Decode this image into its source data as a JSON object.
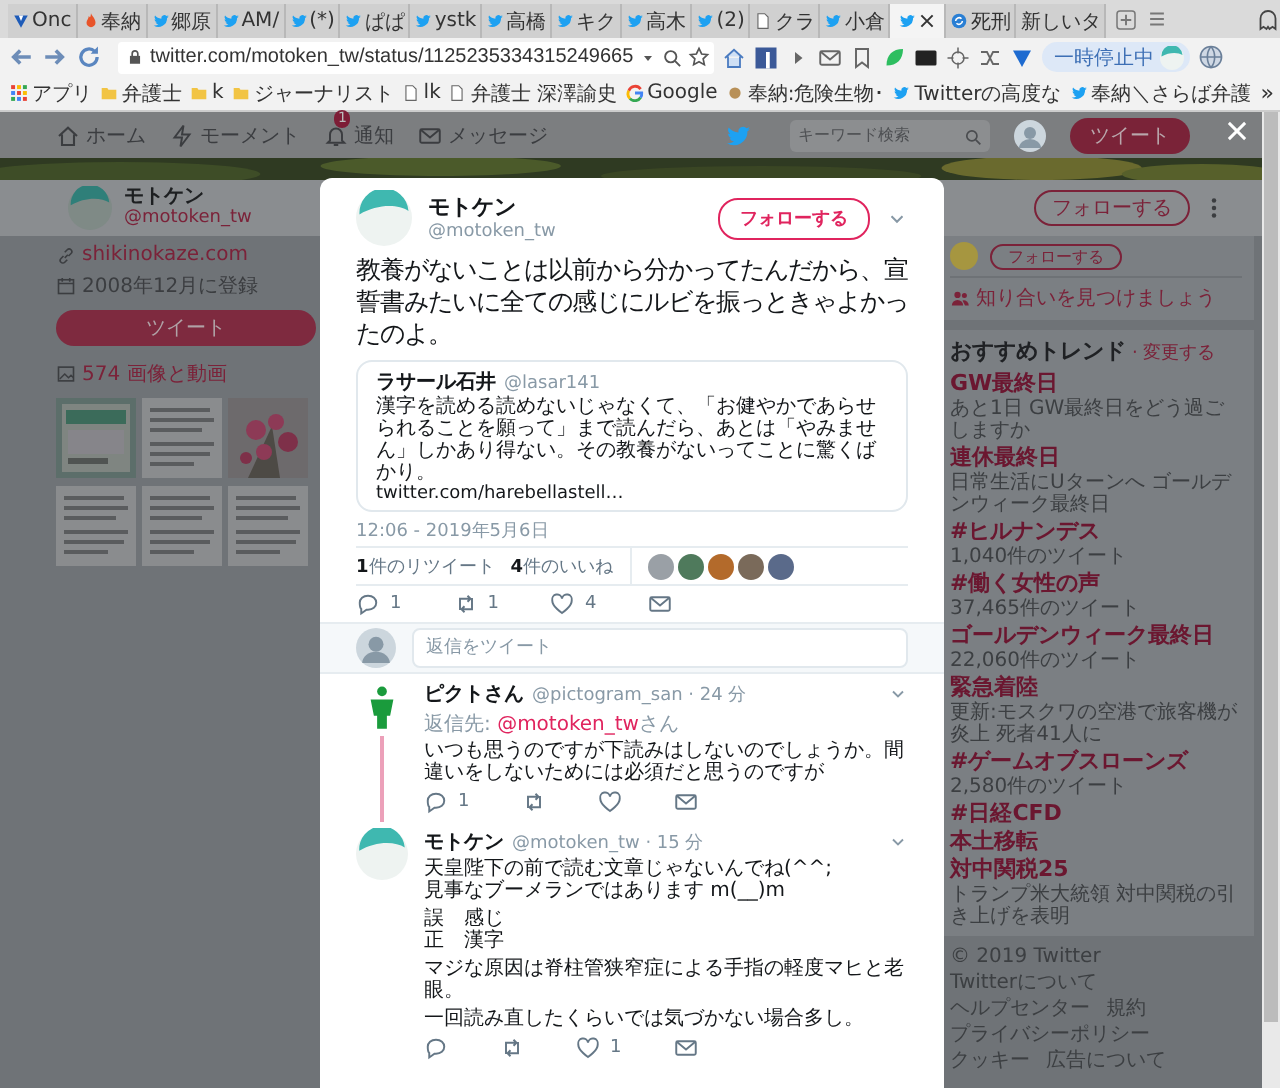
{
  "browser": {
    "tabs": [
      {
        "label": "Onc",
        "kind": "triangle",
        "selected": false
      },
      {
        "label": "奉納",
        "kind": "flame",
        "selected": false
      },
      {
        "label": "郷原",
        "kind": "bird",
        "selected": false
      },
      {
        "label": "AM/",
        "kind": "bird",
        "selected": false
      },
      {
        "label": "(*)",
        "kind": "bird",
        "selected": false
      },
      {
        "label": "ぱぱ",
        "kind": "bird",
        "selected": false
      },
      {
        "label": "ystk",
        "kind": "bird",
        "selected": false
      },
      {
        "label": "高橋",
        "kind": "bird",
        "selected": false
      },
      {
        "label": "キク",
        "kind": "bird",
        "selected": false
      },
      {
        "label": "高木",
        "kind": "bird",
        "selected": false
      },
      {
        "label": "(2)",
        "kind": "bird",
        "selected": false
      },
      {
        "label": "クラ",
        "kind": "page",
        "selected": false
      },
      {
        "label": "小倉",
        "kind": "bird",
        "selected": false
      },
      {
        "kind": "bird",
        "selected": true
      },
      {
        "label": "死刑",
        "kind": "sync",
        "selected": false
      },
      {
        "label": "新しいタ",
        "kind": "plain",
        "selected": false
      }
    ],
    "address": "twitter.com/motoken_tw/status/1125235334315249665",
    "pause_button": "一時停止中",
    "bookmarks": [
      {
        "label": "アプリ",
        "kind": "apps"
      },
      {
        "label": "弁護士",
        "kind": "folder"
      },
      {
        "label": "k",
        "kind": "folder"
      },
      {
        "label": "ジャーナリスト",
        "kind": "folder"
      },
      {
        "label": "lk",
        "kind": "page"
      },
      {
        "label": "弁護士 深澤諭史",
        "kind": "page"
      },
      {
        "label": "Google",
        "kind": "ring"
      },
      {
        "label": "奉納:危険生物･",
        "kind": "dot"
      },
      {
        "label": "Twitterの高度な",
        "kind": "bird"
      },
      {
        "label": "奉納＼さらば弁護",
        "kind": "bird"
      }
    ],
    "more_bookmarks": "»"
  },
  "twitter_nav": {
    "items": [
      {
        "label": "ホーム",
        "kind": "home"
      },
      {
        "label": "モーメント",
        "kind": "bolt"
      },
      {
        "label": "通知",
        "kind": "bell",
        "badge": "1"
      },
      {
        "label": "メッセージ",
        "kind": "mail"
      }
    ],
    "search": {
      "placeholder": "キーワード検索"
    },
    "tweet_button": "ツイート"
  },
  "profile": {
    "name": "モトケン",
    "handle": "@motoken_tw",
    "follow_button": "フォローする",
    "url": "shikinokaze.com",
    "joined": "2008年12月に登録",
    "tweet_button": "ツイート",
    "media_link": "574 画像と動画"
  },
  "who_to_follow": {
    "follow_button": "フォローする",
    "find_friends": "知り合いを見つけましょう"
  },
  "trends": {
    "title": "おすすめトレンド",
    "change": "· 変更する",
    "items": [
      {
        "name": "GW最終日",
        "desc": "あと1日 GW最終日をどう過ごしますか"
      },
      {
        "name": "連休最終日",
        "desc": "日常生活にUターンへ ゴールデンウィーク最終日"
      },
      {
        "name": "#ヒルナンデス",
        "desc": "1,040件のツイート"
      },
      {
        "name": "#働く女性の声",
        "desc": "37,465件のツイート"
      },
      {
        "name": "ゴールデンウィーク最終日",
        "desc": "22,060件のツイート"
      },
      {
        "name": "緊急着陸",
        "desc": "更新:モスクワの空港で旅客機が炎上 死者41人に"
      },
      {
        "name": "#ゲームオブスローンズ",
        "desc": "2,580件のツイート"
      },
      {
        "name": "#日経CFD"
      },
      {
        "name": "本土移転"
      },
      {
        "name": "対中関税25",
        "desc": "トランプ米大統領 対中関税の引き上げを表明"
      }
    ]
  },
  "footer": [
    "© 2019 Twitter",
    "Twitterについて",
    "ヘルプセンター",
    "規約",
    "プライバシーポリシー",
    "クッキー",
    "広告について"
  ],
  "tweet": {
    "name": "モトケン",
    "handle": "@motoken_tw",
    "follow_button": "フォローする",
    "text": "教養がないことは以前から分かってたんだから、宣誓書みたいに全ての感じにルビを振っときゃよかったのよ。",
    "quote": {
      "name": "ラサール石井",
      "handle": "@lasar141",
      "text": "漢字を読める読めないじゃなくて、「お健やかであらせられることを願って」まで読んだら、あとは「やみません」しかあり得ない。その教養がないってことに驚くばかり。",
      "link": "twitter.com/harebellastell…"
    },
    "time": "12:06 - 2019年5月6日",
    "retweets": "**1**件のリツイート",
    "likes": "**4**件のいいね",
    "likers": [
      {
        "kind": "avatar"
      },
      {
        "kind": "avatar"
      },
      {
        "kind": "avatar"
      },
      {
        "kind": "avatar"
      },
      {
        "kind": "avatar"
      }
    ],
    "actions": [
      {
        "kind": "reply",
        "count": "1"
      },
      {
        "kind": "retweet",
        "count": "1"
      },
      {
        "kind": "like",
        "count": "4"
      },
      {
        "kind": "message"
      }
    ],
    "reply_field": {
      "placeholder": "返信をツイート"
    }
  },
  "replies": [
    {
      "name": "ピクトさん",
      "meta": "@pictogram_san · 24 分",
      "thread_line": true,
      "reply_to": {
        "prefix": "返信先: ",
        "link": "@motoken_tw",
        "suffix": "さん"
      },
      "paragraphs": [
        [
          "いつも思うのですが下読みはしないのでしょうか。間違いをしないためには必須だと思うのですが"
        ]
      ],
      "actions": [
        {
          "kind": "reply",
          "count": "1"
        },
        {
          "kind": "retweet"
        },
        {
          "kind": "like"
        },
        {
          "kind": "message"
        }
      ]
    },
    {
      "name": "モトケン",
      "meta": "@motoken_tw · 15 分",
      "thread_line": false,
      "paragraphs": [
        [
          "天皇陛下の前で読む文章じゃないんでね(^^;",
          "見事なブーメランではあります m(__)m"
        ],
        [
          "誤　感じ",
          "正　漢字"
        ],
        [
          "マジな原因は脊柱管狭窄症による手指の軽度マヒと老眼。"
        ],
        [
          "一回読み直したくらいでは気づかない場合多し。"
        ]
      ],
      "actions": [
        {
          "kind": "reply"
        },
        {
          "kind": "retweet"
        },
        {
          "kind": "like",
          "count": "1"
        },
        {
          "kind": "message"
        }
      ]
    }
  ]
}
